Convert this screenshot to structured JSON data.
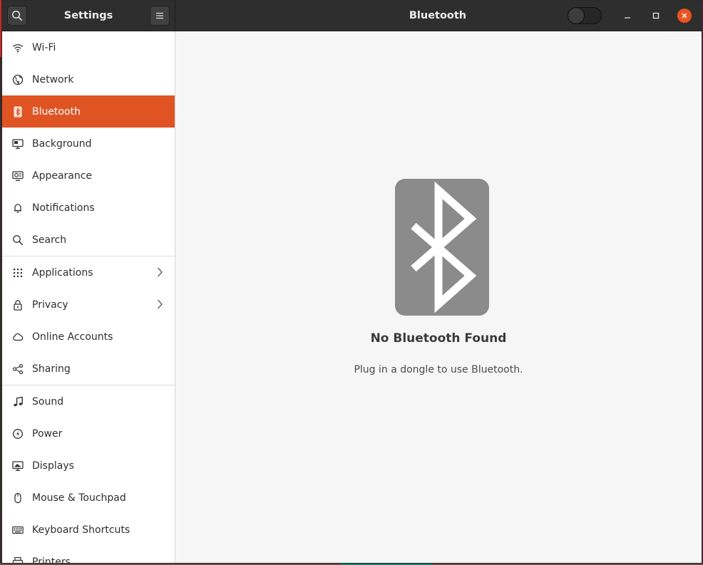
{
  "window": {
    "sidebar_title": "Settings",
    "panel_title": "Bluetooth",
    "accent_color": "#e05424",
    "bluetooth_toggle": "off"
  },
  "sidebar": {
    "items": [
      {
        "label": "Wi-Fi",
        "icon": "wifi-icon"
      },
      {
        "label": "Network",
        "icon": "network-globe-icon"
      },
      {
        "label": "Bluetooth",
        "icon": "bluetooth-icon",
        "active": true
      },
      {
        "label": "Background",
        "icon": "background-monitor-icon"
      },
      {
        "label": "Appearance",
        "icon": "appearance-icon"
      },
      {
        "label": "Notifications",
        "icon": "bell-icon"
      },
      {
        "label": "Search",
        "icon": "search-icon"
      },
      {
        "label": "Applications",
        "icon": "grid-icon",
        "has_submenu": true
      },
      {
        "label": "Privacy",
        "icon": "lock-icon",
        "has_submenu": true
      },
      {
        "label": "Online Accounts",
        "icon": "cloud-icon"
      },
      {
        "label": "Sharing",
        "icon": "share-icon"
      },
      {
        "label": "Sound",
        "icon": "music-note-icon"
      },
      {
        "label": "Power",
        "icon": "power-icon"
      },
      {
        "label": "Displays",
        "icon": "display-icon"
      },
      {
        "label": "Mouse & Touchpad",
        "icon": "mouse-icon"
      },
      {
        "label": "Keyboard Shortcuts",
        "icon": "keyboard-icon"
      },
      {
        "label": "Printers",
        "icon": "printer-icon"
      }
    ]
  },
  "main": {
    "empty_icon": "bluetooth-icon",
    "empty_title": "No Bluetooth Found",
    "empty_subtitle": "Plug in a dongle to use Bluetooth."
  }
}
